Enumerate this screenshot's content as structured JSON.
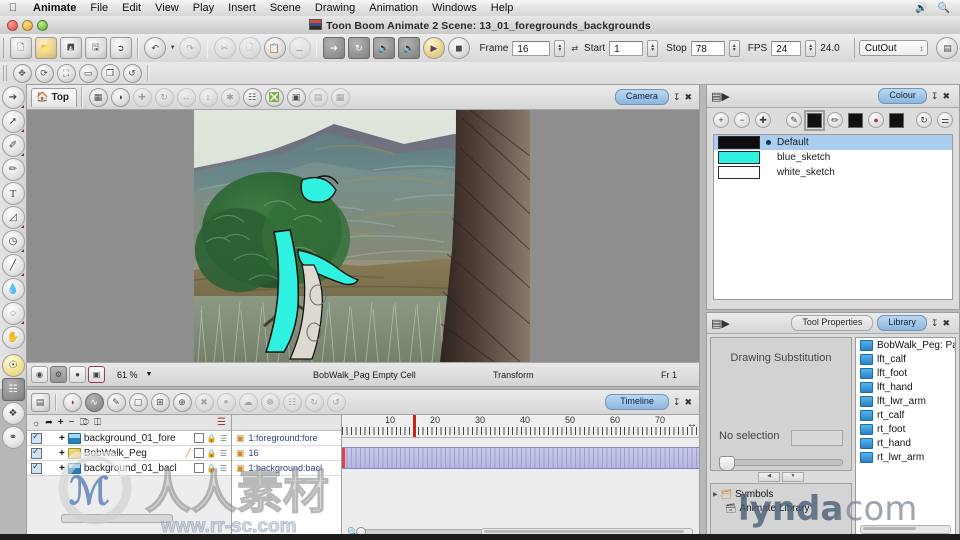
{
  "os_menu": {
    "apple_icon": "apple-icon",
    "items": [
      "Animate",
      "File",
      "Edit",
      "View",
      "Play",
      "Insert",
      "Scene",
      "Drawing",
      "Animation",
      "Windows",
      "Help"
    ],
    "right_icons": [
      "volume-icon",
      "search-icon"
    ]
  },
  "window": {
    "title": "Toon Boom Animate 2 Scene: 13_01_foregrounds_backgrounds",
    "traffic_lights": [
      "close-button",
      "minimize-button",
      "zoom-button"
    ]
  },
  "toolbar": {
    "file_buttons": [
      "new-scene-icon",
      "open-scene-icon",
      "save-icon",
      "save-all-icon",
      "export-icon"
    ],
    "edit_buttons": [
      "undo-icon",
      "redo-icon",
      "cut-icon",
      "copy-icon",
      "paste-icon",
      "delete-icon"
    ],
    "playback_buttons": [
      "select-arrow-icon",
      "loop-icon",
      "sound-on-icon",
      "sound-scrub-icon",
      "play-icon",
      "stop-icon"
    ],
    "frame_label": "Frame",
    "frame_value": "16",
    "start_label": "Start",
    "start_value": "1",
    "stop_label": "Stop",
    "stop_value": "78",
    "fps_label": "FPS",
    "fps_value": "24",
    "fps_actual": "24.0",
    "workspace_value": "CutOut",
    "workspace_manager_icon": "workspace-manager-icon"
  },
  "toolbar2": {
    "buttons": [
      "translate-icon",
      "rotate-icon",
      "scale-icon",
      "skew-icon",
      "flip-icon",
      "reset-icon"
    ]
  },
  "tools": {
    "items": [
      {
        "name": "select-tool",
        "glyph": "↖",
        "selected": false
      },
      {
        "name": "cutter-tool",
        "glyph": "↗",
        "selected": false
      },
      {
        "name": "brush-tool",
        "glyph": "✎",
        "selected": false
      },
      {
        "name": "pencil-tool",
        "glyph": "✏",
        "selected": false
      },
      {
        "name": "text-tool",
        "glyph": "T",
        "selected": false
      },
      {
        "name": "eraser-tool",
        "glyph": "◧",
        "selected": false
      },
      {
        "name": "paint-bucket-tool",
        "glyph": "◕",
        "selected": false
      },
      {
        "name": "line-tool",
        "glyph": "╱",
        "selected": false
      },
      {
        "name": "dropper-tool",
        "glyph": "⚘",
        "selected": false
      },
      {
        "name": "contour-editor-tool",
        "glyph": "◌",
        "selected": false
      },
      {
        "name": "hand-tool",
        "glyph": "✋",
        "selected": false
      },
      {
        "name": "onion-skin-tool",
        "glyph": "●",
        "selected": false,
        "gold": true
      },
      {
        "name": "transform-tool",
        "glyph": "⬚",
        "selected": true
      },
      {
        "name": "animate-tool",
        "glyph": "⌖",
        "selected": false
      },
      {
        "name": "deform-tool",
        "glyph": "◔",
        "selected": false
      }
    ]
  },
  "camera_panel": {
    "view_tab": "Top",
    "view_tab_icon": "home-icon",
    "view_buttons": [
      "grid-icon",
      "onion-skin-icon",
      "rotate-view-icon",
      "reset-rotation-icon",
      "reset-pan-icon",
      "reset-zoom-icon",
      "reset-view-icon",
      "show-grid-icon",
      "light-table-icon",
      "morphing-icon",
      "matte-view-icon",
      "render-view-icon"
    ],
    "tab_label": "Camera",
    "panel_buttons": [
      "collapse-icon",
      "close-icon"
    ],
    "status": {
      "buttons": [
        "render-icon",
        "settings-icon",
        "onion-icon",
        "bounding-box-icon"
      ],
      "zoom": "61 %",
      "zoom_dropdown_icon": "chevron-down-icon",
      "element": "BobWalk_Pag Empty Cell",
      "tool": "Transform",
      "frame": "Fr 1"
    }
  },
  "colour_panel": {
    "menu_icon": "panel-menu-icon",
    "tab_label": "Colour",
    "panel_buttons": [
      "collapse-icon",
      "close-icon"
    ],
    "toolbar_icons": [
      "add-colour-icon",
      "remove-colour-icon",
      "new-texture-icon"
    ],
    "mode_icons": [
      "pencil-line-icon",
      "pencil-swatch-icon",
      "brush-line-icon",
      "brush-swatch-icon",
      "paint-line-icon",
      "paint-swatch-icon",
      "reload-icon",
      "link-icon"
    ],
    "swatches": [
      {
        "name": "Default",
        "colour": "#0d0d0d",
        "selected": true,
        "has_dot": true
      },
      {
        "name": "blue_sketch",
        "colour": "#2ff2e0",
        "selected": false,
        "has_dot": false
      },
      {
        "name": "white_sketch",
        "colour": "#ffffff",
        "selected": false,
        "has_dot": false
      }
    ]
  },
  "library_panel": {
    "menu_icon": "panel-menu-icon",
    "tabs": [
      {
        "label": "Tool Properties",
        "active": false
      },
      {
        "label": "Library",
        "active": true
      }
    ],
    "panel_buttons": [
      "collapse-icon",
      "close-icon"
    ],
    "drawing_substitution_label": "Drawing Substitution",
    "no_selection_label": "No selection",
    "nav_buttons": [
      "prev-drawing-icon",
      "next-drawing-icon"
    ],
    "tree": [
      {
        "label": "Symbols",
        "icon": "symbols-folder-icon",
        "expandable": true
      },
      {
        "label": "Animate Library",
        "icon": "library-folder-icon",
        "expandable": false
      }
    ],
    "items": [
      "BobWalk_Peg: Pat",
      "lft_calf",
      "lft_foot",
      "lft_hand",
      "lft_lwr_arm",
      "rt_calf",
      "rt_foot",
      "rt_hand",
      "rt_lwr_arm"
    ]
  },
  "timeline_panel": {
    "tab_label": "Timeline",
    "panel_buttons": [
      "collapse-icon",
      "close-icon"
    ],
    "mode_buttons": [
      "timeline-view-icon",
      "function-view-icon",
      "exposure-icon",
      "drawing-icon",
      "add-column-icon",
      "add-layer-icon",
      "delete-icon",
      "link-icon",
      "node-icon",
      "symbol-icon",
      "template-icon",
      "sync-icon",
      "loop-icon"
    ],
    "layer_tool_icons": [
      "show-hide-icon",
      "link-icon",
      "add-layer-icon",
      "remove-layer-icon",
      "duplicate-icon",
      "add-peg-icon",
      "split-icon"
    ],
    "layers": [
      {
        "name": "background_01_fore",
        "visible": true,
        "type": "bitmap",
        "has_pencil": false
      },
      {
        "name": "BobWalk_Peg",
        "visible": true,
        "type": "peg",
        "has_pencil": true
      },
      {
        "name": "background_01_bacl",
        "visible": true,
        "type": "bitmap",
        "has_pencil": false
      }
    ],
    "exposures": [
      "1:foreground:fore",
      "16",
      "1:background:bacl"
    ],
    "ruler_labels": [
      "10",
      "20",
      "30",
      "40",
      "50",
      "60",
      "70"
    ],
    "playhead_frame": "16",
    "zoom_icon": "zoom-icon"
  },
  "watermarks": {
    "brand_cn": "人人素材",
    "brand_url": "www.rr-sc.com",
    "lynda": "lynda",
    "lynda_tld": ".com"
  },
  "colors": {
    "accent_tab": "#8cb6de",
    "selection": "#aacdf0",
    "playhead": "#cc2222",
    "track": "#b6b6e0"
  }
}
